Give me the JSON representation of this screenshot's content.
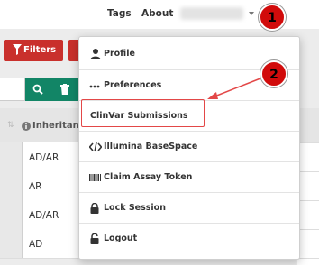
{
  "topnav": {
    "tags_label": "Tags",
    "about_label": "About"
  },
  "toolbar": {
    "filters_label": "Filters",
    "accent_color": "#c9302c",
    "action_color": "#128566"
  },
  "table": {
    "header_label": "Inheritance",
    "rows": [
      "AD/AR",
      "AR",
      "AD/AR",
      "AD"
    ]
  },
  "user_menu": {
    "items": [
      {
        "icon": "user-icon",
        "label": "Profile"
      },
      {
        "icon": "ellipsis-icon",
        "label": "Preferences"
      },
      {
        "icon": "none",
        "label": "ClinVar Submissions"
      },
      {
        "icon": "code-icon",
        "label": "Illumina BaseSpace"
      },
      {
        "icon": "barcode-icon",
        "label": "Claim Assay Token"
      },
      {
        "icon": "lock-icon",
        "label": "Lock Session"
      },
      {
        "icon": "unlock-icon",
        "label": "Logout"
      }
    ]
  },
  "annotations": {
    "badge_1": "1",
    "badge_2": "2",
    "highlight_color": "#e34848"
  }
}
